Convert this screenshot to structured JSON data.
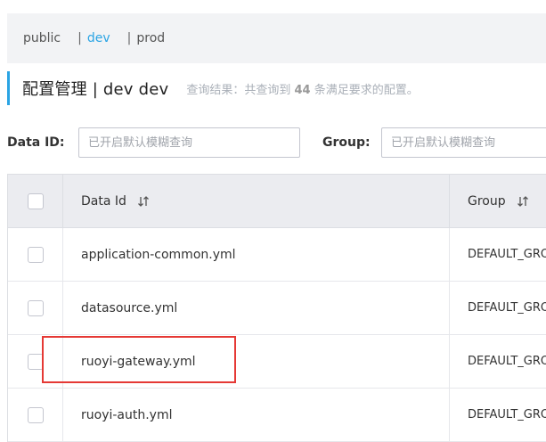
{
  "namespaces": {
    "items": [
      "public",
      "dev",
      "prod"
    ],
    "separator": "|"
  },
  "header": {
    "title": "配置管理 | dev dev",
    "summary_prefix": "查询结果：共查询到",
    "summary_count": "44",
    "summary_suffix": "条满足要求的配置。"
  },
  "filters": {
    "data_id_label": "Data ID:",
    "data_id_placeholder": "已开启默认模糊查询",
    "group_label": "Group:",
    "group_placeholder": "已开启默认模糊查询"
  },
  "table": {
    "columns": [
      "Data Id",
      "Group"
    ],
    "rows": [
      {
        "data_id": "application-common.yml",
        "group": "DEFAULT_GROUP"
      },
      {
        "data_id": "datasource.yml",
        "group": "DEFAULT_GROUP"
      },
      {
        "data_id": "ruoyi-gateway.yml",
        "group": "DEFAULT_GROUP"
      },
      {
        "data_id": "ruoyi-auth.yml",
        "group": "DEFAULT_GROUP"
      }
    ]
  },
  "colors": {
    "accent": "#2aa4e4",
    "highlight": "#e53935"
  }
}
